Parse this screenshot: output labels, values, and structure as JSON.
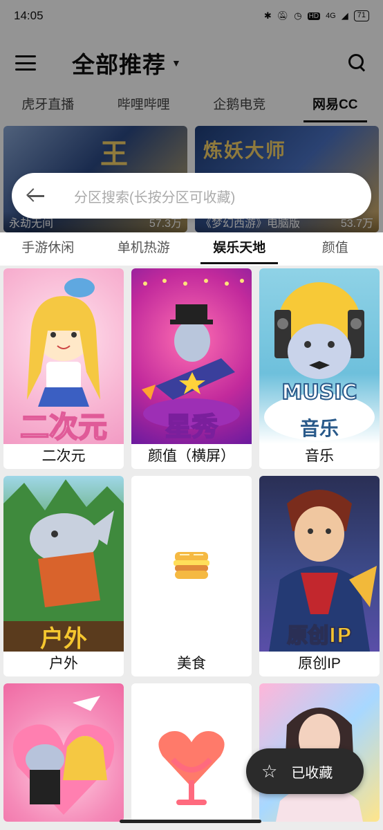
{
  "status_bar": {
    "time": "14:05",
    "network": "4G",
    "battery": "71",
    "icons": [
      "bluetooth-icon",
      "mute-icon",
      "alarm-icon",
      "hd-icon",
      "signal-icon",
      "battery-icon"
    ]
  },
  "header": {
    "title": "全部推荐",
    "caret": "▼"
  },
  "platform_tabs": [
    "虎牙直播",
    "哔哩哔哩",
    "企鹅电竞",
    "网易CC"
  ],
  "background_cards": [
    {
      "title": "永劫无间",
      "viewers": "57.3万",
      "art_text": "王"
    },
    {
      "title": "《梦幻西游》电脑版",
      "viewers": "53.7万",
      "art_text": "炼妖大师"
    }
  ],
  "search": {
    "placeholder": "分区搜索(长按分区可收藏)"
  },
  "category_tabs": [
    "手游休闲",
    "单机热游",
    "娱乐天地",
    "颜值"
  ],
  "active_category": "娱乐天地",
  "tiles": [
    {
      "label": "二次元",
      "art_text": "二次元"
    },
    {
      "label": "颜值（横屏）",
      "art_text": "星秀"
    },
    {
      "label": "音乐",
      "art_text": "MUSIC",
      "art_sub": "音乐"
    },
    {
      "label": "户外",
      "art_text": "户外"
    },
    {
      "label": "美食",
      "art_text": ""
    },
    {
      "label": "原创IP",
      "art_text": "原创IP"
    },
    {
      "label": "",
      "art_text": ""
    },
    {
      "label": "",
      "art_text": ""
    },
    {
      "label": "",
      "art_text": ""
    }
  ],
  "fab": {
    "label": "已收藏",
    "icon": "star-outline-icon"
  },
  "colors": {
    "overlay": "#000000",
    "sheet_bg": "#ececec",
    "fab_bg": "#2b2b2b"
  }
}
